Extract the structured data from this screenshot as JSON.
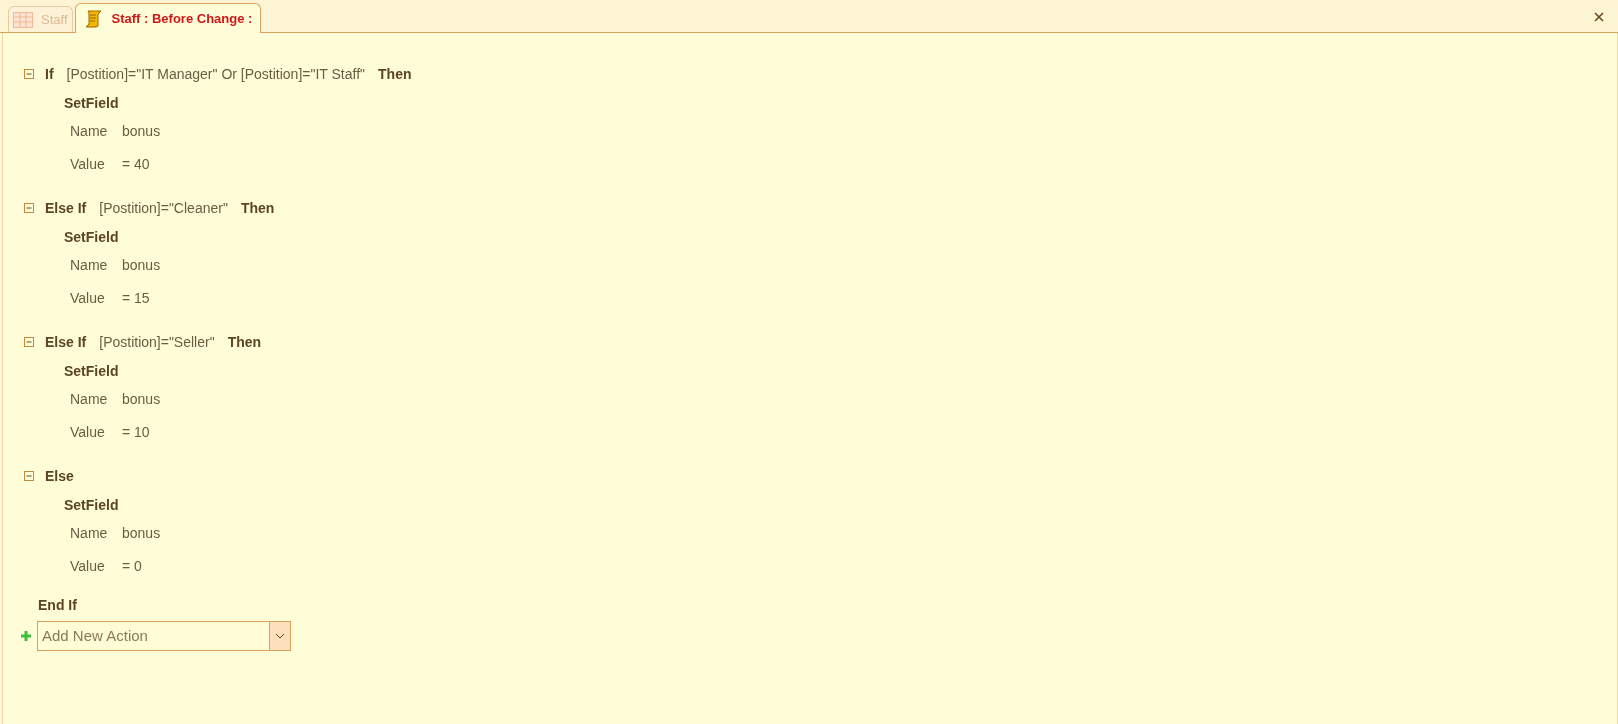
{
  "tabs": [
    {
      "label": "Staff",
      "kind": "table",
      "selected": false
    },
    {
      "label": "Staff : Before Change :",
      "kind": "macro",
      "selected": true
    }
  ],
  "blocks": [
    {
      "keyword": "If",
      "condition": "[Postition]=\"IT Manager\" Or [Postition]=\"IT Staff\"",
      "then": "Then",
      "expanded": true,
      "action": {
        "name": "SetField",
        "args": [
          {
            "label": "Name",
            "value": "bonus"
          },
          {
            "label": "Value",
            "value": "= 40"
          }
        ]
      }
    },
    {
      "keyword": "Else If",
      "condition": "[Postition]=\"Cleaner\"",
      "then": "Then",
      "expanded": true,
      "action": {
        "name": "SetField",
        "args": [
          {
            "label": "Name",
            "value": "bonus"
          },
          {
            "label": "Value",
            "value": "= 15"
          }
        ]
      }
    },
    {
      "keyword": "Else If",
      "condition": "[Postition]=\"Seller\"",
      "then": "Then",
      "expanded": true,
      "action": {
        "name": "SetField",
        "args": [
          {
            "label": "Name",
            "value": "bonus"
          },
          {
            "label": "Value",
            "value": "= 10"
          }
        ]
      }
    },
    {
      "keyword": "Else",
      "expanded": true,
      "action": {
        "name": "SetField",
        "args": [
          {
            "label": "Name",
            "value": "bonus"
          },
          {
            "label": "Value",
            "value": "= 0"
          }
        ]
      }
    }
  ],
  "end": "End If",
  "add_action": {
    "placeholder": "Add New Action"
  }
}
